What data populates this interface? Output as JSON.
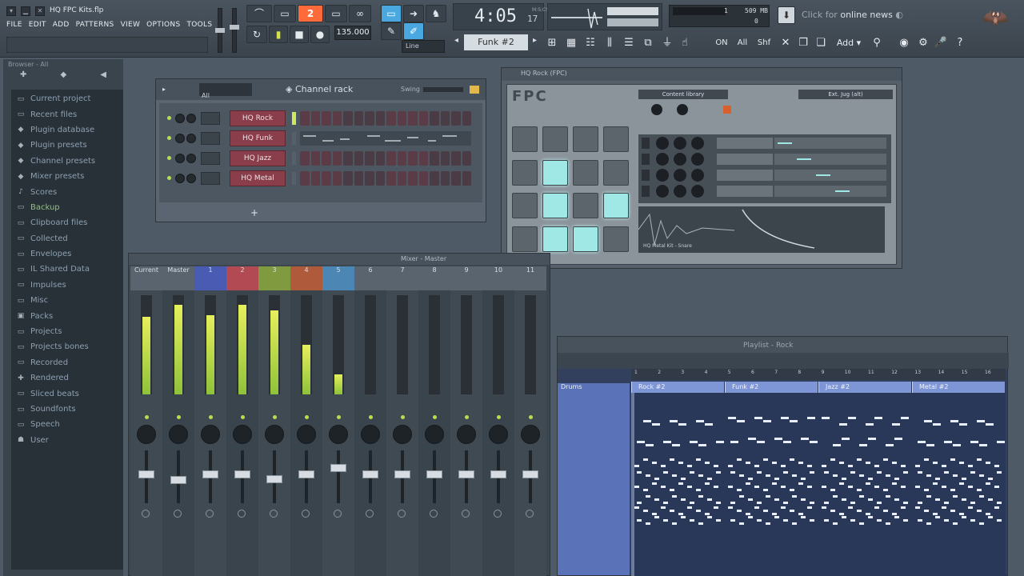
{
  "app": {
    "title": "HQ FPC Kits.flp",
    "menu": [
      "FILE",
      "EDIT",
      "ADD",
      "PATTERNS",
      "VIEW",
      "OPTIONS",
      "TOOLS",
      "?"
    ]
  },
  "transport": {
    "tempo": "135.000",
    "time_main": "4:05",
    "time_sub": "17",
    "time_mode": "M:S:CS",
    "pattern": "Funk #2",
    "line_mode": "Line",
    "cpu_left": "1",
    "cpu_right": "0",
    "memory": "509 MB",
    "news_prefix": "Click for",
    "news_text": "online news",
    "add_label": "Add"
  },
  "browser": {
    "header": "Browser - All",
    "items": [
      {
        "label": "Current project",
        "icon": "folder-icon"
      },
      {
        "label": "Recent files",
        "icon": "folder-icon"
      },
      {
        "label": "Plugin database",
        "icon": "plug-icon"
      },
      {
        "label": "Plugin presets",
        "icon": "plug-icon"
      },
      {
        "label": "Channel presets",
        "icon": "plug-icon"
      },
      {
        "label": "Mixer presets",
        "icon": "plug-icon"
      },
      {
        "label": "Scores",
        "icon": "note-icon"
      },
      {
        "label": "Backup",
        "icon": "folder-icon"
      },
      {
        "label": "Clipboard files",
        "icon": "folder-icon"
      },
      {
        "label": "Collected",
        "icon": "folder-icon"
      },
      {
        "label": "Envelopes",
        "icon": "folder-icon"
      },
      {
        "label": "IL Shared Data",
        "icon": "folder-icon"
      },
      {
        "label": "Impulses",
        "icon": "folder-icon"
      },
      {
        "label": "Misc",
        "icon": "folder-icon"
      },
      {
        "label": "Packs",
        "icon": "pack-icon"
      },
      {
        "label": "Projects",
        "icon": "folder-icon"
      },
      {
        "label": "Projects bones",
        "icon": "folder-icon"
      },
      {
        "label": "Recorded",
        "icon": "folder-icon"
      },
      {
        "label": "Rendered",
        "icon": "render-icon"
      },
      {
        "label": "Sliced beats",
        "icon": "folder-icon"
      },
      {
        "label": "Soundfonts",
        "icon": "folder-icon"
      },
      {
        "label": "Speech",
        "icon": "folder-icon"
      },
      {
        "label": "User",
        "icon": "user-icon"
      }
    ]
  },
  "channel_rack": {
    "filter": "All",
    "title": "Channel rack",
    "swing_label": "Swing",
    "add_label": "+",
    "channels": [
      {
        "name": "HQ Rock",
        "selected": true,
        "mode": "steps"
      },
      {
        "name": "HQ Funk",
        "selected": false,
        "mode": "pianoroll"
      },
      {
        "name": "HQ Jazz",
        "selected": false,
        "mode": "steps"
      },
      {
        "name": "HQ Metal",
        "selected": false,
        "mode": "steps"
      }
    ]
  },
  "fpc": {
    "title": "HQ Rock (FPC)",
    "logo": "FPC",
    "preset": "Content library",
    "kit": "Ext. Jug (alt)",
    "lit_pads": [
      5,
      9,
      11,
      13,
      14
    ],
    "sample": "HQ Metal Kit - Snare"
  },
  "mixer": {
    "title": "Mixer - Master",
    "strips": [
      {
        "label": "Current",
        "color": "#59646e",
        "level": 0.78,
        "fader": 0.55
      },
      {
        "label": "Master",
        "color": "#59646e",
        "level": 0.9,
        "fader": 0.42
      },
      {
        "label": "1",
        "color": "#4a5bb3",
        "level": 0.8,
        "fader": 0.55
      },
      {
        "label": "2",
        "color": "#b14a52",
        "level": 0.9,
        "fader": 0.55
      },
      {
        "label": "3",
        "color": "#7f9a3f",
        "level": 0.85,
        "fader": 0.45
      },
      {
        "label": "4",
        "color": "#b05a3c",
        "level": 0.5,
        "fader": 0.55
      },
      {
        "label": "5",
        "color": "#4c86b5",
        "level": 0.2,
        "fader": 0.7
      },
      {
        "label": "6",
        "color": "#59646e",
        "level": 0,
        "fader": 0.55
      },
      {
        "label": "7",
        "color": "#59646e",
        "level": 0,
        "fader": 0.55
      },
      {
        "label": "8",
        "color": "#59646e",
        "level": 0,
        "fader": 0.55
      },
      {
        "label": "9",
        "color": "#59646e",
        "level": 0,
        "fader": 0.55
      },
      {
        "label": "10",
        "color": "#59646e",
        "level": 0,
        "fader": 0.55
      },
      {
        "label": "11",
        "color": "#59646e",
        "level": 0,
        "fader": 0.55
      }
    ]
  },
  "playlist": {
    "title": "Playlist - Rock",
    "track": "Drums",
    "ruler": [
      "1",
      "2",
      "3",
      "4",
      "5",
      "6",
      "7",
      "8",
      "9",
      "10",
      "11",
      "12",
      "13",
      "14",
      "15",
      "16"
    ],
    "clips": [
      "Rock #2",
      "Funk #2",
      "Jazz #2",
      "Metal #2"
    ]
  }
}
